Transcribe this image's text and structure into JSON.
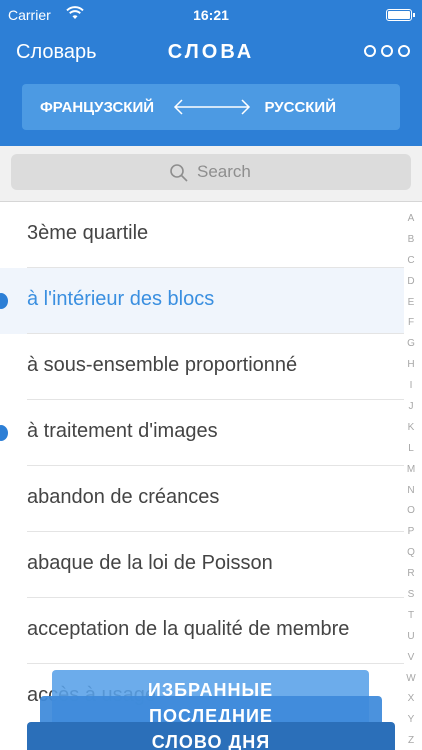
{
  "status": {
    "carrier": "Carrier",
    "time": "16:21"
  },
  "nav": {
    "back_label": "Словарь",
    "title": "СЛОВА",
    "more_icon": "more-icon"
  },
  "languages": {
    "from": "ФРАНЦУЗСКИЙ",
    "to": "РУССКИЙ"
  },
  "search": {
    "placeholder": "Search"
  },
  "entries": [
    {
      "text": "3ème quartile",
      "selected": false,
      "marked": false
    },
    {
      "text": "à l'intérieur des blocs",
      "selected": true,
      "marked": true
    },
    {
      "text": "à sous-ensemble proportionné",
      "selected": false,
      "marked": false
    },
    {
      "text": "à traitement d'images",
      "selected": false,
      "marked": true
    },
    {
      "text": "abandon de créances",
      "selected": false,
      "marked": false
    },
    {
      "text": "abaque de la loi de Poisson",
      "selected": false,
      "marked": false
    },
    {
      "text": "acceptation de la qualité de membre",
      "selected": false,
      "marked": false
    },
    {
      "text": "accès à usage",
      "selected": false,
      "marked": false
    }
  ],
  "index_letters": [
    "A",
    "B",
    "C",
    "D",
    "E",
    "F",
    "G",
    "H",
    "I",
    "J",
    "K",
    "L",
    "M",
    "N",
    "O",
    "P",
    "Q",
    "R",
    "S",
    "T",
    "U",
    "V",
    "W",
    "X",
    "Y",
    "Z"
  ],
  "tabs": {
    "favorites": "ИЗБРАННЫЕ",
    "recent": "ПОСЛЕДНИЕ",
    "word_of_day": "СЛОВО ДНЯ"
  },
  "colors": {
    "primary": "#2d7fd6",
    "selected_text": "#3a8fe0"
  }
}
